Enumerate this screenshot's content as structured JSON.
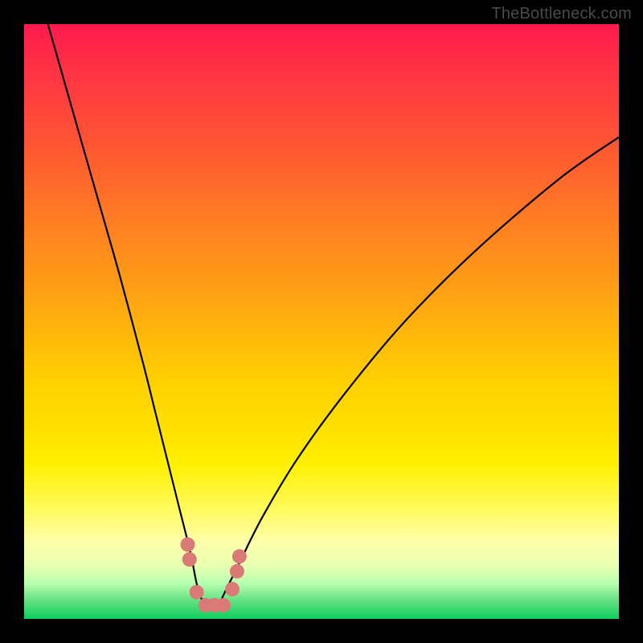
{
  "watermark": "TheBottleneck.com",
  "colors": {
    "frame": "#000000",
    "curve_stroke": "#000000",
    "marker_fill": "#da7a77",
    "gradient_top": "#ff1a4d",
    "gradient_bottom": "#10d060"
  },
  "chart_data": {
    "type": "line",
    "title": "",
    "xlabel": "",
    "ylabel": "",
    "xlim": [
      0,
      100
    ],
    "ylim": [
      0,
      100
    ],
    "grid": false,
    "legend": false,
    "series": [
      {
        "name": "bottleneck-curve",
        "x": [
          4,
          8,
          12,
          16,
          20,
          22,
          24,
          26,
          28,
          29,
          30,
          31,
          32,
          33,
          34,
          36,
          40,
          46,
          54,
          64,
          76,
          90,
          100
        ],
        "y": [
          100,
          86,
          72,
          58,
          43,
          35,
          27,
          19,
          11,
          6,
          3,
          2,
          2,
          3,
          5,
          9,
          17,
          27,
          38,
          50,
          62,
          74,
          81
        ]
      }
    ],
    "markers": [
      {
        "x": 27.5,
        "y": 12.5
      },
      {
        "x": 27.8,
        "y": 10.0
      },
      {
        "x": 29.0,
        "y": 4.5
      },
      {
        "x": 30.5,
        "y": 2.3
      },
      {
        "x": 32.0,
        "y": 2.3
      },
      {
        "x": 33.5,
        "y": 2.3
      },
      {
        "x": 35.0,
        "y": 5.0
      },
      {
        "x": 35.8,
        "y": 8.0
      },
      {
        "x": 36.2,
        "y": 10.5
      }
    ],
    "marker_radius_px": 9
  }
}
